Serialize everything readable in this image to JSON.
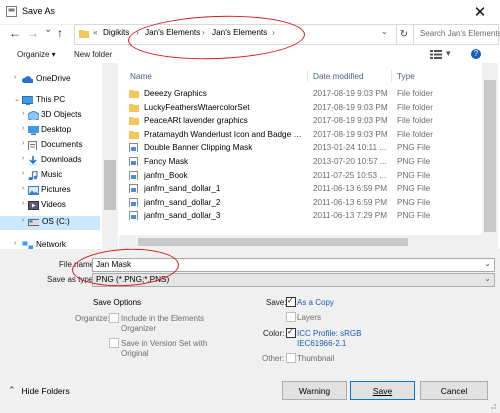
{
  "window": {
    "title": "Save As",
    "close_glyph": "✕"
  },
  "nav": {
    "back": "←",
    "forward": "→",
    "dropdown": "⌄",
    "up": "↑"
  },
  "breadcrumb": {
    "overflow": "«",
    "items": [
      "Digikits",
      "Jan's Elements",
      "Jan's Elements"
    ],
    "separator": "›",
    "dropdown": "⌄"
  },
  "refresh_glyph": "↻",
  "search": {
    "placeholder": "Search Jan's Elements"
  },
  "toolbar": {
    "organize": "Organize ▾",
    "new_folder": "New folder",
    "help": "?"
  },
  "navpane": [
    {
      "label": "OneDrive",
      "icon": "cloud-icon"
    },
    {
      "label": "This PC",
      "icon": "computer-icon"
    },
    {
      "label": "3D Objects",
      "icon": "3d-objects-icon"
    },
    {
      "label": "Desktop",
      "icon": "desktop-icon"
    },
    {
      "label": "Documents",
      "icon": "documents-icon"
    },
    {
      "label": "Downloads",
      "icon": "downloads-icon"
    },
    {
      "label": "Music",
      "icon": "music-icon"
    },
    {
      "label": "Pictures",
      "icon": "pictures-icon"
    },
    {
      "label": "Videos",
      "icon": "videos-icon"
    },
    {
      "label": "OS (C:)",
      "icon": "drive-icon"
    },
    {
      "label": "Network",
      "icon": "network-icon"
    }
  ],
  "columns": {
    "name": "Name",
    "date": "Date modified",
    "type": "Type"
  },
  "files": [
    {
      "name": "Deeezy Graphics",
      "date": "2017-08-19 9:03 PM",
      "type": "File folder",
      "icon": "folder-icon"
    },
    {
      "name": "LuckyFeathersWtaercolorSet",
      "date": "2017-08-19 9:03 PM",
      "type": "File folder",
      "icon": "folder-icon"
    },
    {
      "name": "PeaceARt lavender graphics",
      "date": "2017-08-19 9:03 PM",
      "type": "File folder",
      "icon": "folder-icon"
    },
    {
      "name": "Pratamaydh Wanderlust Icon and Badge Pa...",
      "date": "2017-08-19 9:03 PM",
      "type": "File folder",
      "icon": "folder-icon"
    },
    {
      "name": "Double Banner Clipping Mask",
      "date": "2013-01-24 10:11 ...",
      "type": "PNG File",
      "icon": "png-file-icon"
    },
    {
      "name": "Fancy Mask",
      "date": "2013-07-20 10:57 ...",
      "type": "PNG File",
      "icon": "png-file-icon"
    },
    {
      "name": "janfrn_Book",
      "date": "2011-07-25 10:53 ...",
      "type": "PNG File",
      "icon": "png-file-icon"
    },
    {
      "name": "janfrn_sand_dollar_1",
      "date": "2011-06-13 6:59 PM",
      "type": "PNG File",
      "icon": "png-file-icon"
    },
    {
      "name": "janfrn_sand_dollar_2",
      "date": "2011-06-13 6:59 PM",
      "type": "PNG File",
      "icon": "png-file-icon"
    },
    {
      "name": "janfrn_sand_dollar_3",
      "date": "2011-06-13 7:29 PM",
      "type": "PNG File",
      "icon": "png-file-icon"
    }
  ],
  "form": {
    "filename_label": "File name:",
    "filename_value": "Jan Mask",
    "saveas_label": "Save as type:",
    "saveas_value": "PNG (*.PNG;*.PNS)"
  },
  "options": {
    "title": "Save Options",
    "organize_label": "Organize:",
    "include_elements": "Include in the Elements Organizer",
    "version_set": "Save in Version Set with Original",
    "save_label": "Save:",
    "as_copy": "As a Copy",
    "layers": "Layers",
    "color_label": "Color:",
    "icc_profile": "ICC Profile:  sRGB IEC61966-2.1",
    "other_label": "Other:",
    "thumbnail": "Thumbnail"
  },
  "footer": {
    "hide_folders": "Hide Folders",
    "hide_glyph": "⌃",
    "warning": "Warning",
    "save": "Save",
    "cancel": "Cancel"
  },
  "colors": {
    "accent": "#0078d7",
    "folder": "#f2c85b",
    "annotation": "#d91b1b",
    "panel": "#f0f0f0"
  }
}
